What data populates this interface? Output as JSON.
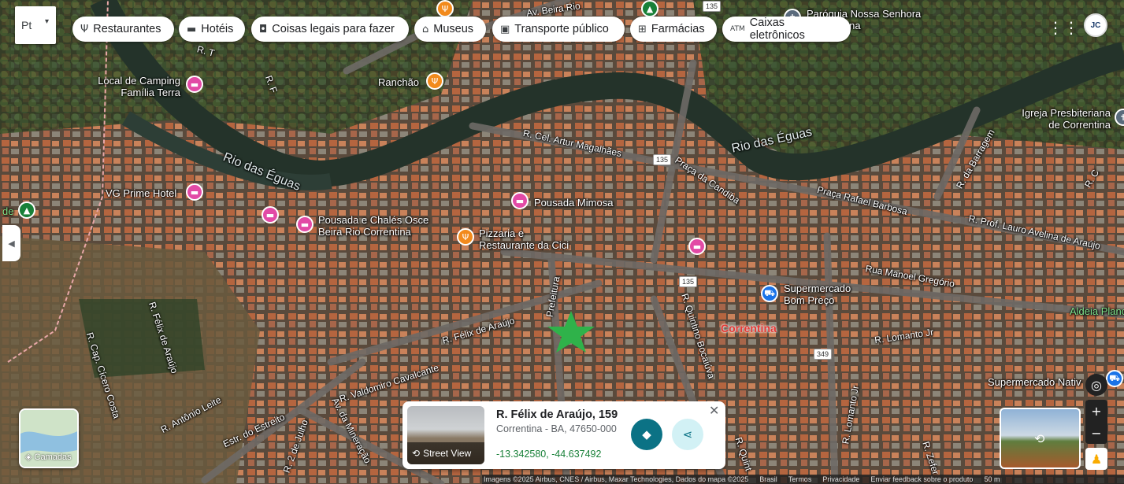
{
  "language_button": {
    "label": "Pt"
  },
  "categories": [
    {
      "icon": "fork-knife-icon",
      "label": "Restaurantes"
    },
    {
      "icon": "bed-icon",
      "label": "Hotéis"
    },
    {
      "icon": "camera-icon",
      "label": "Coisas legais para fazer"
    },
    {
      "icon": "museum-icon",
      "label": "Museus"
    },
    {
      "icon": "train-icon",
      "label": "Transporte público"
    },
    {
      "icon": "pharmacy-icon",
      "label": "Farmácias"
    },
    {
      "icon": "atm-icon",
      "label": "Caixas eletrônicos"
    }
  ],
  "account": {
    "initials": "JC"
  },
  "map": {
    "rivers": [
      "Rio das Éguas",
      "Rio das Éguas"
    ],
    "streets": [
      "R. T",
      "R. F",
      "Av. Beira Rio",
      "R. Cel. Artur Magalhães",
      "Praça da Candiba",
      "Praça Rafael Barbosa",
      "R. Prof. Lauro Avelina de Araújo",
      "Rua Manoel Gregório",
      "R. Félix de Araújo",
      "R. Félix de Araújo",
      "R. Cap. Cícero Costa",
      "R. Valdomiro Cavalcante",
      "R. Antônio Leite",
      "Estr. do Estreito",
      "R. 2 de Julho",
      "Av. da Mineração",
      "Prefeitura",
      "R. Quintino Bocaiúva",
      "R. Lomanto Jr",
      "R. Lomanto Jr",
      "R. da Barragem",
      "R. C",
      "R. Quint",
      "R. Zefer"
    ],
    "city_label": "Correntina",
    "area_label": "Aldeia Planc",
    "road_shields": [
      "135",
      "135",
      "135",
      "349"
    ],
    "pois": [
      {
        "type": "hotel",
        "label": "Local de Camping\nFamília Terra"
      },
      {
        "type": "food",
        "label": "Ranchão"
      },
      {
        "type": "hotel",
        "label": "VG Prime Hotel"
      },
      {
        "type": "hotel",
        "label": "Pousada e Chalés Osce\nBeira Rio Correntina"
      },
      {
        "type": "hotel",
        "label": "Pousada Mimosa"
      },
      {
        "type": "food",
        "label": "Pizzaria e\nRestaurante da Cici"
      },
      {
        "type": "shop",
        "label": "Supermercado\nBom Preço"
      },
      {
        "type": "shop",
        "label": "Supermercado Nativ"
      },
      {
        "type": "church",
        "label": "Paróquia Nossa Senhora\n- Correntina"
      },
      {
        "type": "church",
        "label": "Igreja Presbiteriana\nde Correntina"
      },
      {
        "type": "hotel",
        "label": ""
      },
      {
        "type": "hotel",
        "label": ""
      },
      {
        "type": "park",
        "label": "de"
      }
    ]
  },
  "layers_button": {
    "label": "Camadas"
  },
  "place_card": {
    "title": "R. Félix de Araújo, 159",
    "subtitle": "Correntina - BA, 47650-000",
    "coords": "-13.342580, -44.637492",
    "streetview_label": "Street View"
  },
  "footer": {
    "attribution": "Imagens ©2025 Airbus, CNES / Airbus, Maxar Technologies, Dados do mapa ©2025",
    "links": [
      "Brasil",
      "Termos",
      "Privacidade",
      "Enviar feedback sobre o produto"
    ],
    "scale": "50 m"
  },
  "colors": {
    "marker": "#2fb24a",
    "hotel_pin": "#e24aa6",
    "food_pin": "#f28a1c",
    "shop_pin": "#1a73e8",
    "city_label": "#e53935"
  }
}
